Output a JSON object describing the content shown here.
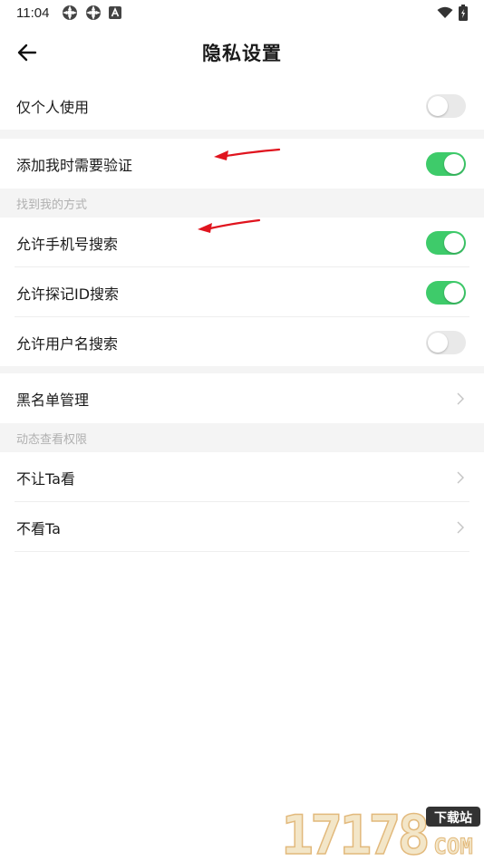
{
  "status_bar": {
    "time": "11:04",
    "left_icons": [
      "settings-gear-icon",
      "settings-gear-icon",
      "accessibility-a-icon"
    ],
    "right_icons": [
      "wifi-icon",
      "battery-charging-icon"
    ]
  },
  "header": {
    "title": "隐私设置",
    "back_icon": "arrow-left-icon"
  },
  "rows": {
    "only_personal": {
      "label": "仅个人使用",
      "toggle_on": false
    },
    "verify_add": {
      "label": "添加我时需要验证",
      "toggle_on": true
    },
    "allow_phone": {
      "label": "允许手机号搜索",
      "toggle_on": true
    },
    "allow_id": {
      "label": "允许探记ID搜索",
      "toggle_on": true
    },
    "allow_username": {
      "label": "允许用户名搜索",
      "toggle_on": false
    },
    "blacklist": {
      "label": "黑名单管理"
    },
    "hide_from": {
      "label": "不让Ta看"
    },
    "not_view": {
      "label": "不看Ta"
    }
  },
  "sections": {
    "find_me": "找到我的方式",
    "moments_permission": "动态查看权限"
  },
  "watermark": {
    "digits": "17178",
    "badge": "下载站",
    "domain": "COM"
  },
  "colors": {
    "toggle_on": "#3ecb6a",
    "toggle_off": "#e9e9e9",
    "section_bg": "#f4f4f4",
    "section_text": "#b0b0b0",
    "annotation_arrow": "#e0141e"
  }
}
